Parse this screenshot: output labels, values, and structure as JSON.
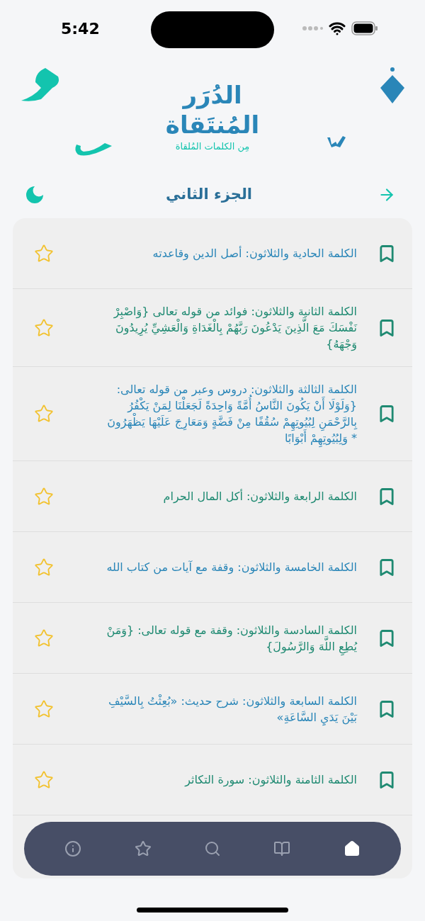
{
  "status_bar": {
    "time": "5:42"
  },
  "logo": {
    "title_line_1": "الدُرَر",
    "title_line_2": "المُنتَقاة",
    "subtitle": "مِن الكلمات المُلقاة"
  },
  "header": {
    "title": "الجزء الثاني"
  },
  "items": [
    {
      "title": "الكلمة الحادية والثلاثون: أصل الدين وقاعدته",
      "color": "#2a86b8",
      "bookmarked": false,
      "starred": false
    },
    {
      "title": "الكلمة الثانية والثلاثون: فوائد من قوله تعالى {وَاصْبِرْ نَفْسَكَ مَعَ الَّذِينَ يَدْعُونَ رَبَّهُمْ بِالْغَدَاةِ وَالْعَشِيِّ يُرِيدُونَ وَجْهَهُ}",
      "color": "#1f8a72",
      "bookmarked": false,
      "starred": false
    },
    {
      "title": "الكلمة الثالثة والثلاثون: دروس وعبر من قوله تعالى: {وَلَوْلَا أَنْ يَكُونَ النَّاسُ أُمَّةً وَاحِدَةً لَجَعَلْنَا لِمَنْ يَكْفُرُ بِالرَّحْمَنِ لِبُيُوتِهِمْ سُقُفًا مِنْ فَضَّةٍ وَمَعَارِجَ عَلَيْهَا يَظْهَرُونَ * وَلِبُيُوتِهِمْ أَبْوَابًا",
      "color": "#2a86b8",
      "bookmarked": false,
      "starred": false
    },
    {
      "title": "الكلمة الرابعة والثلاثون: أكل المال الحرام",
      "color": "#1f8a72",
      "bookmarked": false,
      "starred": false
    },
    {
      "title": "الكلمة الخامسة والثلاثون: وقفة مع آيات من كتاب الله",
      "color": "#2a86b8",
      "bookmarked": false,
      "starred": false
    },
    {
      "title": "الكلمة السادسة والثلاثون: وقفة مع قوله تعالى: {وَمَنْ يُطِعِ اللَّهَ وَالرَّسُولَ}",
      "color": "#1f8a72",
      "bookmarked": false,
      "starred": false
    },
    {
      "title": "الكلمة السابعة والثلاثون: شرح حديث: «بُعِثْتُ بِالسَّيْفِ بَيْنَ يَدَيِ السَّاعَةِ»",
      "color": "#2a86b8",
      "bookmarked": false,
      "starred": false
    },
    {
      "title": "الكلمة الثامنة والثلاثون: سورة التكاثر",
      "color": "#1f8a72",
      "bookmarked": false,
      "starred": false
    }
  ],
  "tab_bar": [
    {
      "kind": "home",
      "selected": true
    },
    {
      "kind": "book",
      "selected": false
    },
    {
      "kind": "search",
      "selected": false
    },
    {
      "kind": "star",
      "selected": false
    },
    {
      "kind": "info",
      "selected": false
    }
  ]
}
